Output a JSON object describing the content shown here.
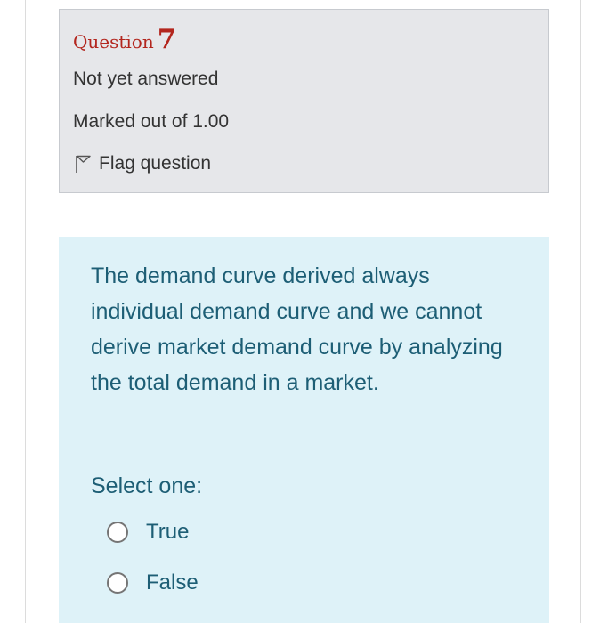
{
  "question_info": {
    "heading_word": "Question",
    "number": "7",
    "state": "Not yet answered",
    "marks": "Marked out of 1.00",
    "flag_label": "Flag question",
    "flag_icon": "flag-outline-icon"
  },
  "question": {
    "text": "The demand curve derived always individual demand curve and we cannot derive market demand curve by analyzing the total demand in a market.",
    "prompt": "Select one:",
    "options": [
      {
        "label": "True",
        "selected": false
      },
      {
        "label": "False",
        "selected": false
      }
    ]
  },
  "colors": {
    "heading_red": "#b3261e",
    "info_background": "#e6e7ea",
    "question_background": "#def2f8",
    "question_text": "#1d5e75"
  }
}
